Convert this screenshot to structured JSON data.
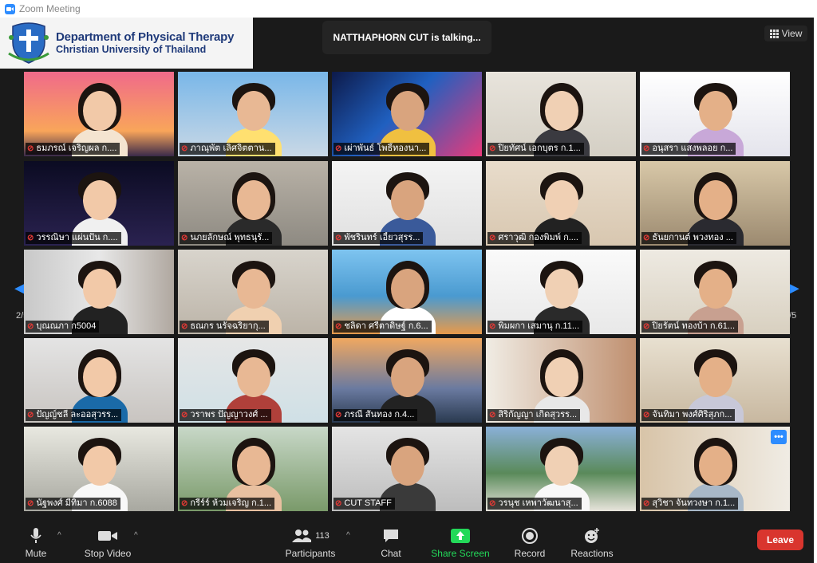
{
  "window": {
    "title": "Zoom Meeting"
  },
  "logo": {
    "line1": "Department of Physical Therapy",
    "line2": "Christian University of Thailand"
  },
  "talking": "NATTHAPHORN CUT  is talking...",
  "view_button": "View",
  "pagination": {
    "left": "2/5",
    "right": "2/5"
  },
  "participants": [
    {
      "name": "ธมภรณ์ เจริญผล ก....",
      "muted": true
    },
    {
      "name": "ภาณุพัต เลิศจิตตาน...",
      "muted": true
    },
    {
      "name": "เผ่าพันธ์ โพธิ์ทองนา...",
      "muted": true
    },
    {
      "name": "ปิยทัศน์ เอกบุตร ก.1...",
      "muted": true
    },
    {
      "name": "อนุสรา แสงพลอย ก...",
      "muted": true
    },
    {
      "name": "วรรณิษา แผ่นปั่น ก....",
      "muted": true
    },
    {
      "name": "นภยลักษณ์ พุทธนุรั...",
      "muted": true
    },
    {
      "name": "พัชรินทร์ เอี้ยวสุรร...",
      "muted": true
    },
    {
      "name": "ศราวุฒิ กองพิมพ์ ก....",
      "muted": true
    },
    {
      "name": "ธันยกานต์ พวงทอง ...",
      "muted": true
    },
    {
      "name": "บุณณภา ก5004",
      "muted": true
    },
    {
      "name": "ธณกร นรัจฉริยากุ...",
      "muted": true
    },
    {
      "name": "ชลิดา ศรีตาดิษฐ์ ก.6...",
      "muted": true
    },
    {
      "name": "พิมผกา เสมานุ ก.11...",
      "muted": true
    },
    {
      "name": "ปิยรัตน์ ทองบ้า ก.61...",
      "muted": true
    },
    {
      "name": "ปัญญ์ชลี ละออสุวรร...",
      "muted": true
    },
    {
      "name": "วราพร ปัญญาวงศ์ ...",
      "muted": true
    },
    {
      "name": "ภรณี  สันทอง  ก.4...",
      "muted": true
    },
    {
      "name": "สิริกัญญา เกิดสุวรร...",
      "muted": true
    },
    {
      "name": "จันทิมา พงศ์ศิริสุภก...",
      "muted": true
    },
    {
      "name": "นัฐพงศ์ มีทิมา ก.6088",
      "muted": true
    },
    {
      "name": "กรีร์ร์ ห้วมเจริญ ก.1...",
      "muted": true
    },
    {
      "name": "CUT STAFF",
      "muted": true
    },
    {
      "name": "วรนุช เหพาวัฒนาสุ...",
      "muted": true
    },
    {
      "name": "สุวิชา จันทวงษา ก.1...",
      "muted": true
    }
  ],
  "toolbar": {
    "mute": "Mute",
    "stop_video": "Stop Video",
    "participants": "Participants",
    "participants_count": "113",
    "chat": "Chat",
    "share_screen": "Share Screen",
    "record": "Record",
    "reactions": "Reactions",
    "leave": "Leave"
  },
  "colors": {
    "accent": "#2D8CFF",
    "share": "#23D959",
    "leave": "#D9352E",
    "background": "#1A1A1A"
  }
}
